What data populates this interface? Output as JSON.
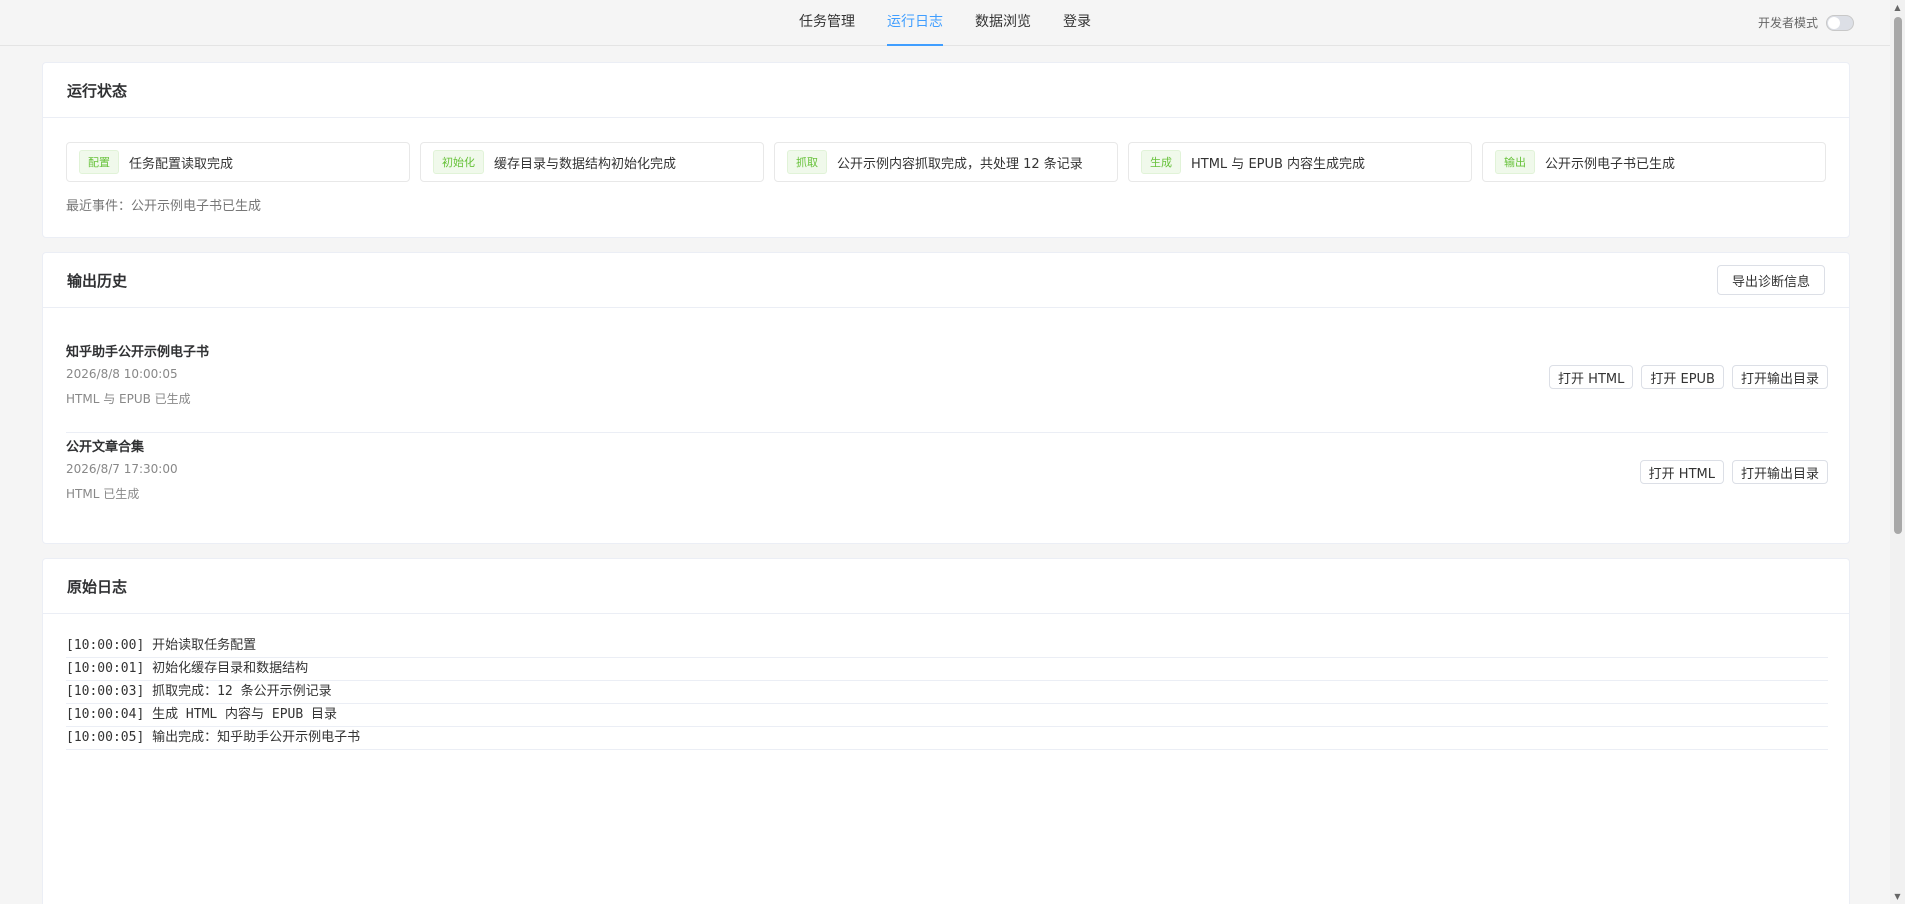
{
  "nav": {
    "items": [
      {
        "label": "任务管理",
        "active": false
      },
      {
        "label": "运行日志",
        "active": true
      },
      {
        "label": "数据浏览",
        "active": false
      },
      {
        "label": "登录",
        "active": false
      }
    ],
    "dev_mode_label": "开发者模式",
    "dev_mode_on": false,
    "accent_color": "#409eff"
  },
  "status": {
    "title": "运行状态",
    "steps": [
      {
        "tag": "配置",
        "text": "任务配置读取完成"
      },
      {
        "tag": "初始化",
        "text": "缓存目录与数据结构初始化完成"
      },
      {
        "tag": "抓取",
        "text": "公开示例内容抓取完成，共处理 12 条记录"
      },
      {
        "tag": "生成",
        "text": "HTML 与 EPUB 内容生成完成"
      },
      {
        "tag": "输出",
        "text": "公开示例电子书已生成"
      }
    ],
    "recent_event": "最近事件：公开示例电子书已生成",
    "tag_color": "#67c23a"
  },
  "history": {
    "title": "输出历史",
    "export_label": "导出诊断信息",
    "items": [
      {
        "title": "知乎助手公开示例电子书",
        "time": "2026/8/8 10:00:05",
        "desc": "HTML 与 EPUB 已生成",
        "actions": [
          "打开 HTML",
          "打开 EPUB",
          "打开输出目录"
        ]
      },
      {
        "title": "公开文章合集",
        "time": "2026/8/7 17:30:00",
        "desc": "HTML 已生成",
        "actions": [
          "打开 HTML",
          "打开输出目录"
        ]
      }
    ]
  },
  "log": {
    "title": "原始日志",
    "lines": [
      "[10:00:00] 开始读取任务配置",
      "[10:00:01] 初始化缓存目录和数据结构",
      "[10:00:03] 抓取完成：12 条公开示例记录",
      "[10:00:04] 生成 HTML 内容与 EPUB 目录",
      "[10:00:05] 输出完成：知乎助手公开示例电子书"
    ]
  }
}
